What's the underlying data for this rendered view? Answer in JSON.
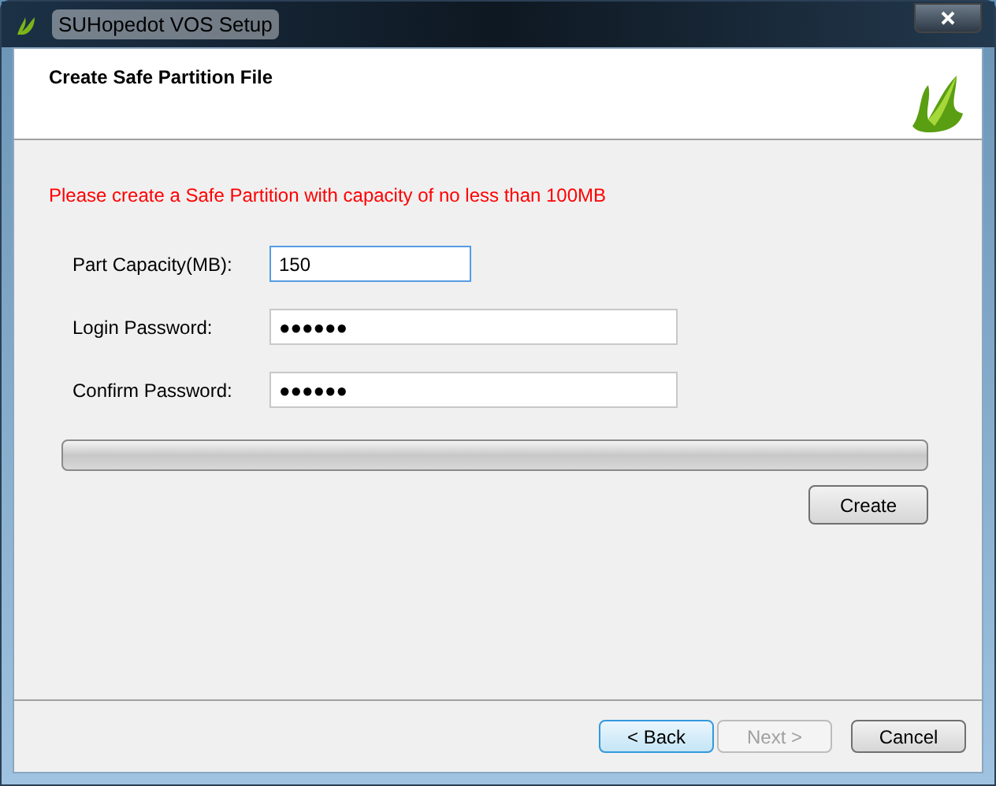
{
  "window": {
    "title": "SUHopedot VOS Setup"
  },
  "header": {
    "title": "Create Safe Partition File"
  },
  "notice": "Please create a Safe Partition with capacity of no less than 100MB",
  "fields": [
    {
      "label": "Part Capacity(MB):",
      "value": "150",
      "focused": true
    },
    {
      "label": "Login Password:",
      "value": "●●●●●●",
      "focused": false
    },
    {
      "label": "Confirm Password:",
      "value": "●●●●●●",
      "focused": false
    }
  ],
  "progress": {
    "level": 0
  },
  "create_button": "Create",
  "buttons": [
    {
      "label": "< Back",
      "disabled": false,
      "default": true
    },
    {
      "label": "Next >",
      "disabled": true,
      "default": false
    },
    {
      "label": "Cancel",
      "disabled": false,
      "default": false
    }
  ]
}
